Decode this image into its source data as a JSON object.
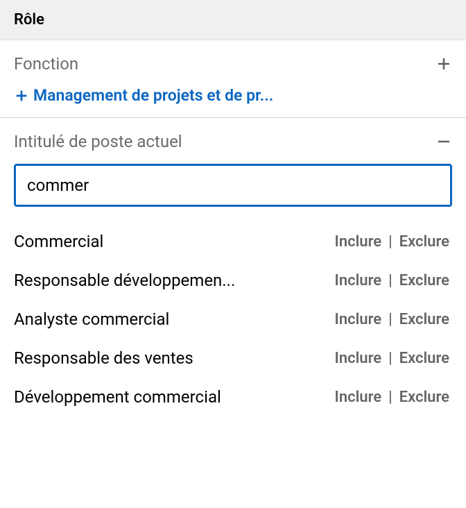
{
  "section": {
    "title": "Rôle"
  },
  "fonction": {
    "title": "Fonction",
    "chip": {
      "label": "Management de projets et de pr..."
    }
  },
  "intitule": {
    "title": "Intitulé de poste actuel",
    "input_value": "commer"
  },
  "suggestions": [
    {
      "label": "Commercial",
      "include": "Inclure",
      "exclude": "Exclure"
    },
    {
      "label": "Responsable développemen...",
      "include": "Inclure",
      "exclude": "Exclure"
    },
    {
      "label": "Analyste commercial",
      "include": "Inclure",
      "exclude": "Exclure"
    },
    {
      "label": "Responsable des ventes",
      "include": "Inclure",
      "exclude": "Exclure"
    },
    {
      "label": "Développement commercial",
      "include": "Inclure",
      "exclude": "Exclure"
    }
  ]
}
